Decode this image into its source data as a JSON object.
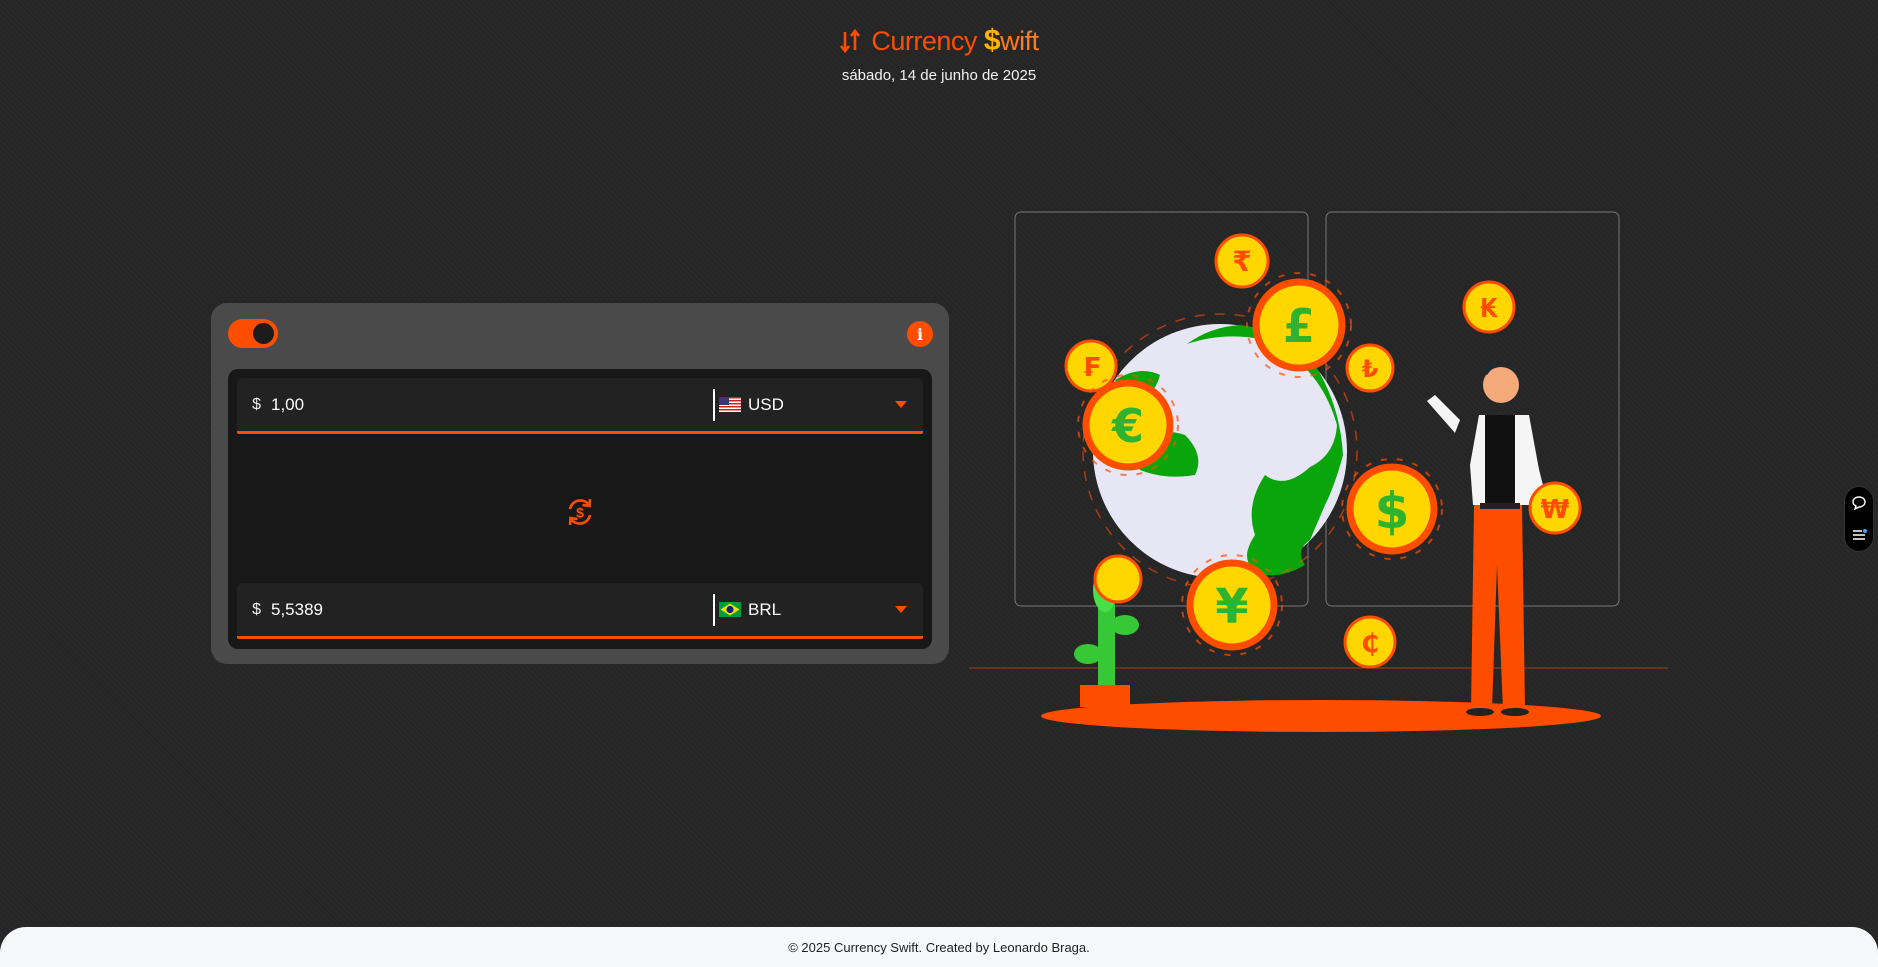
{
  "header": {
    "logo_currency": "Currency",
    "logo_s": "$",
    "logo_wift": "wift",
    "date": "sábado, 14 de junho de 2025"
  },
  "converter": {
    "from": {
      "symbol": "$",
      "amount": "1,00",
      "currency": "USD",
      "flag": "us-flag-icon"
    },
    "to": {
      "symbol": "$",
      "amount": "5,5389",
      "currency": "BRL",
      "flag": "br-flag-icon"
    },
    "toggle_state": "on",
    "info_icon": "i"
  },
  "illustration": {
    "coin_symbols": [
      "₹",
      "£",
      "₣",
      "₺",
      "€",
      "₭",
      "$",
      "₩",
      "¥",
      "₵"
    ]
  },
  "footer": {
    "text": "© 2025 Currency Swift. Created by Leonardo Braga."
  },
  "colors": {
    "accent": "#ff4d00",
    "background": "#262626",
    "panel": "#4a4a4a",
    "inner": "#181818",
    "coin": "#ffd600",
    "globe": "#0aa50a"
  }
}
